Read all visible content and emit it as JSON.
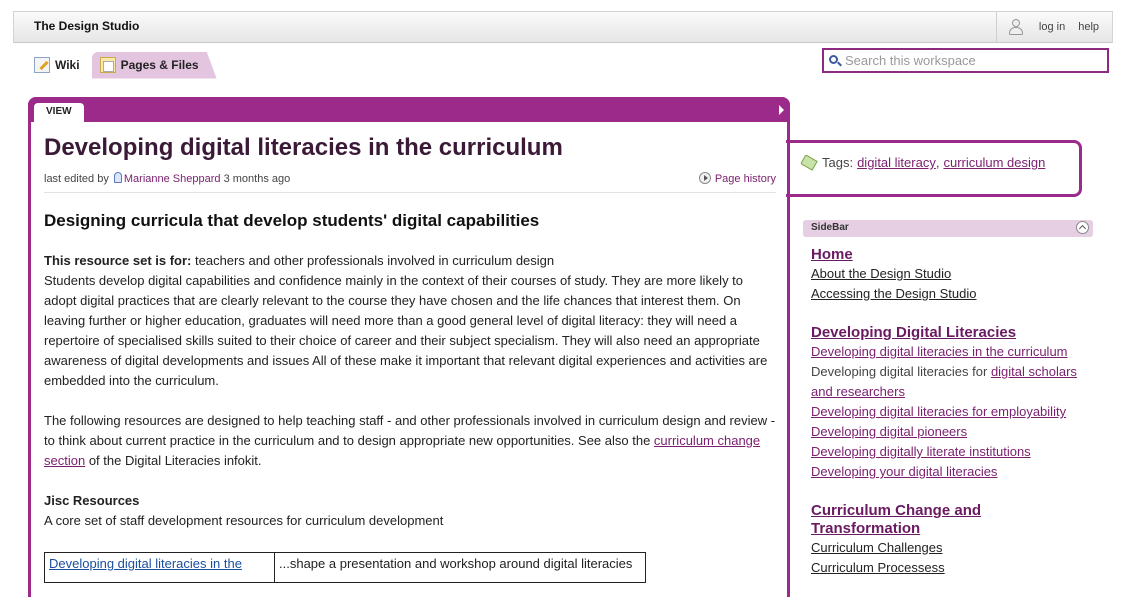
{
  "app": {
    "title": "The Design Studio"
  },
  "top_links": {
    "login": "log in",
    "help": "help"
  },
  "nav": {
    "wiki": "Wiki",
    "pages_files": "Pages & Files"
  },
  "search": {
    "placeholder": "Search this workspace"
  },
  "view_tab": "VIEW",
  "page": {
    "title": "Developing digital literacies in the curriculum",
    "meta_prefix": "last edited by",
    "editor": "Marianne Sheppard",
    "edited_ago": "3 months ago",
    "history": "Page history",
    "subheading": "Designing curricula that develop students' digital capabilities",
    "audience_label": "This resource set is for:",
    "audience_text": " teachers and other professionals involved in curriculum design",
    "para1": "Students develop digital capabilities and confidence mainly in the context of their courses of study. They are more likely to adopt digital practices that are clearly relevant to the course they have chosen and the life chances that interest them. On leaving further or higher education, graduates will need more than a good general level of digital literacy: they will need a repertoire of specialised skills suited to their choice of career and their subject specialism. They will also need an appropriate awareness of digital developments and issues  All of these make it important that relevant digital experiences and activities are embedded into the curriculum.",
    "para2_pre": "The following resources are designed to help teaching staff - and other professionals involved in curriculum design and review - to think about current practice in the curriculum and to design appropriate new opportunities. See also the ",
    "para2_link": "curriculum change section",
    "para2_post": " of the Digital Literacies infokit.",
    "jisc_heading": "Jisc Resources",
    "jisc_text": "A core set of staff development resources for curriculum development",
    "table": [
      {
        "resource": "Developing digital literacies in the",
        "desc": "...shape a presentation and workshop around digital literacies"
      }
    ]
  },
  "tags": {
    "label": "Tags:",
    "items": [
      "digital literacy",
      "curriculum design"
    ]
  },
  "sidebar": {
    "title": "SideBar",
    "home": "Home",
    "home_links": [
      "About the Design Studio",
      "Accessing the Design Studio"
    ],
    "ddl_heading": "Developing Digital Literacies",
    "ddl_link1": "Developing digital literacies in the curriculum",
    "ddl_line2_pre": "Developing digital literacies for ",
    "ddl_line2_link": "digital scholars and researchers",
    "ddl_links": [
      "Developing digital literacies for employability",
      "Developing digital pioneers",
      "Developing digitally literate institutions",
      "Developing your digital literacies"
    ],
    "cct_heading": "Curriculum Change and Transformation",
    "cct_links": [
      "Curriculum Challenges",
      "Curriculum Processess"
    ]
  }
}
